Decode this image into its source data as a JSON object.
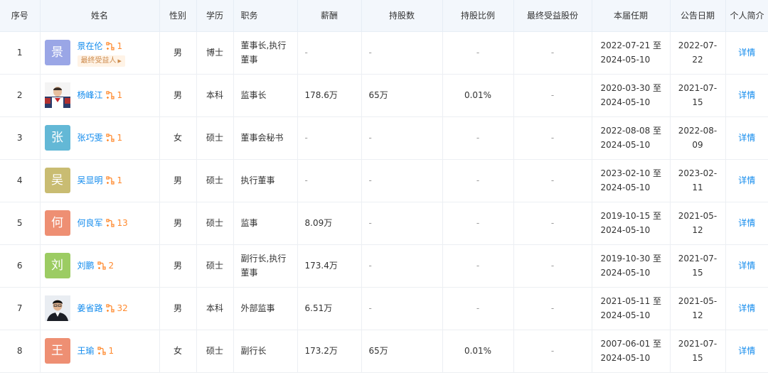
{
  "headers": [
    "序号",
    "姓名",
    "性别",
    "学历",
    "职务",
    "薪酬",
    "持股数",
    "持股比例",
    "最终受益股份",
    "本届任期",
    "公告日期",
    "个人简介"
  ],
  "ubo_tag": "最终受益人",
  "rows": [
    {
      "no": "1",
      "avatar_char": "景",
      "avatar_color": "#9aa6e6",
      "avatar_type": "text",
      "name": "景在伦",
      "rel": "1",
      "ubo": true,
      "gender": "男",
      "edu": "博士",
      "position": "董事长,执行董事",
      "salary": "-",
      "shares": "-",
      "ratio": "-",
      "benefit": "-",
      "term": "2022-07-21 至 2024-05-10",
      "date": "2022-07-22",
      "detail": "详情"
    },
    {
      "no": "2",
      "avatar_char": "",
      "avatar_color": "#ffffff",
      "avatar_type": "photo1",
      "name": "杨峰江",
      "rel": "1",
      "ubo": false,
      "gender": "男",
      "edu": "本科",
      "position": "监事长",
      "salary": "178.6万",
      "shares": "65万",
      "ratio": "0.01%",
      "benefit": "-",
      "term": "2020-03-30 至 2024-05-10",
      "date": "2021-07-15",
      "detail": "详情"
    },
    {
      "no": "3",
      "avatar_char": "张",
      "avatar_color": "#63b8d6",
      "avatar_type": "text",
      "name": "张巧雯",
      "rel": "1",
      "ubo": false,
      "gender": "女",
      "edu": "硕士",
      "position": "董事会秘书",
      "salary": "-",
      "shares": "-",
      "ratio": "-",
      "benefit": "-",
      "term": "2022-08-08 至 2024-05-10",
      "date": "2022-08-09",
      "detail": "详情"
    },
    {
      "no": "4",
      "avatar_char": "吴",
      "avatar_color": "#c9bc72",
      "avatar_type": "text",
      "name": "吴显明",
      "rel": "1",
      "ubo": false,
      "gender": "男",
      "edu": "硕士",
      "position": "执行董事",
      "salary": "-",
      "shares": "-",
      "ratio": "-",
      "benefit": "-",
      "term": "2023-02-10 至 2024-05-10",
      "date": "2023-02-11",
      "detail": "详情"
    },
    {
      "no": "5",
      "avatar_char": "何",
      "avatar_color": "#ee8f73",
      "avatar_type": "text",
      "name": "何良军",
      "rel": "13",
      "ubo": false,
      "gender": "男",
      "edu": "硕士",
      "position": "监事",
      "salary": "8.09万",
      "shares": "-",
      "ratio": "-",
      "benefit": "-",
      "term": "2019-10-15 至 2024-05-10",
      "date": "2021-05-12",
      "detail": "详情"
    },
    {
      "no": "6",
      "avatar_char": "刘",
      "avatar_color": "#9ccc63",
      "avatar_type": "text",
      "name": "刘鹏",
      "rel": "2",
      "ubo": false,
      "gender": "男",
      "edu": "硕士",
      "position": "副行长,执行董事",
      "salary": "173.4万",
      "shares": "-",
      "ratio": "-",
      "benefit": "-",
      "term": "2019-10-30 至 2024-05-10",
      "date": "2021-07-15",
      "detail": "详情"
    },
    {
      "no": "7",
      "avatar_char": "",
      "avatar_color": "#ffffff",
      "avatar_type": "photo2",
      "name": "姜省路",
      "rel": "32",
      "ubo": false,
      "gender": "男",
      "edu": "本科",
      "position": "外部监事",
      "salary": "6.51万",
      "shares": "-",
      "ratio": "-",
      "benefit": "-",
      "term": "2021-05-11 至 2024-05-10",
      "date": "2021-05-12",
      "detail": "详情"
    },
    {
      "no": "8",
      "avatar_char": "王",
      "avatar_color": "#ee8f73",
      "avatar_type": "text",
      "name": "王瑜",
      "rel": "1",
      "ubo": false,
      "gender": "女",
      "edu": "硕士",
      "position": "副行长",
      "salary": "173.2万",
      "shares": "65万",
      "ratio": "0.01%",
      "benefit": "-",
      "term": "2007-06-01 至 2024-05-10",
      "date": "2021-07-15",
      "detail": "详情"
    }
  ]
}
